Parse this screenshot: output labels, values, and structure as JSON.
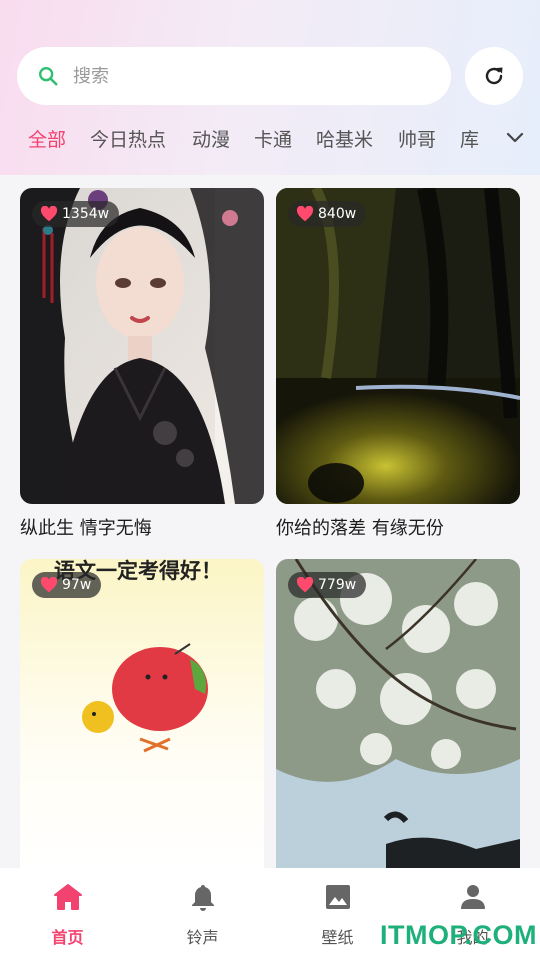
{
  "search": {
    "placeholder": "搜索"
  },
  "tabs": [
    {
      "label": "全部",
      "active": true
    },
    {
      "label": "今日热点",
      "active": false
    },
    {
      "label": "动漫",
      "active": false
    },
    {
      "label": "卡通",
      "active": false
    },
    {
      "label": "哈基米",
      "active": false
    },
    {
      "label": "帅哥",
      "active": false
    },
    {
      "label": "库",
      "active": false
    }
  ],
  "cards": [
    {
      "likes": "1354w",
      "title": "纵此生 情字无悔"
    },
    {
      "likes": "840w",
      "title": "你给的落差 有缘无份"
    },
    {
      "likes": "97w",
      "title": "",
      "image_text": "语文一定考得好！"
    },
    {
      "likes": "779w",
      "title": ""
    }
  ],
  "nav": [
    {
      "label": "首页",
      "icon": "home-icon",
      "active": true
    },
    {
      "label": "铃声",
      "icon": "bell-icon",
      "active": false
    },
    {
      "label": "壁纸",
      "icon": "image-icon",
      "active": false
    },
    {
      "label": "我的",
      "icon": "person-icon",
      "active": false
    }
  ],
  "watermark": "ITMOP.COM",
  "colors": {
    "accent": "#f2426f",
    "search_icon": "#2fbf71"
  }
}
